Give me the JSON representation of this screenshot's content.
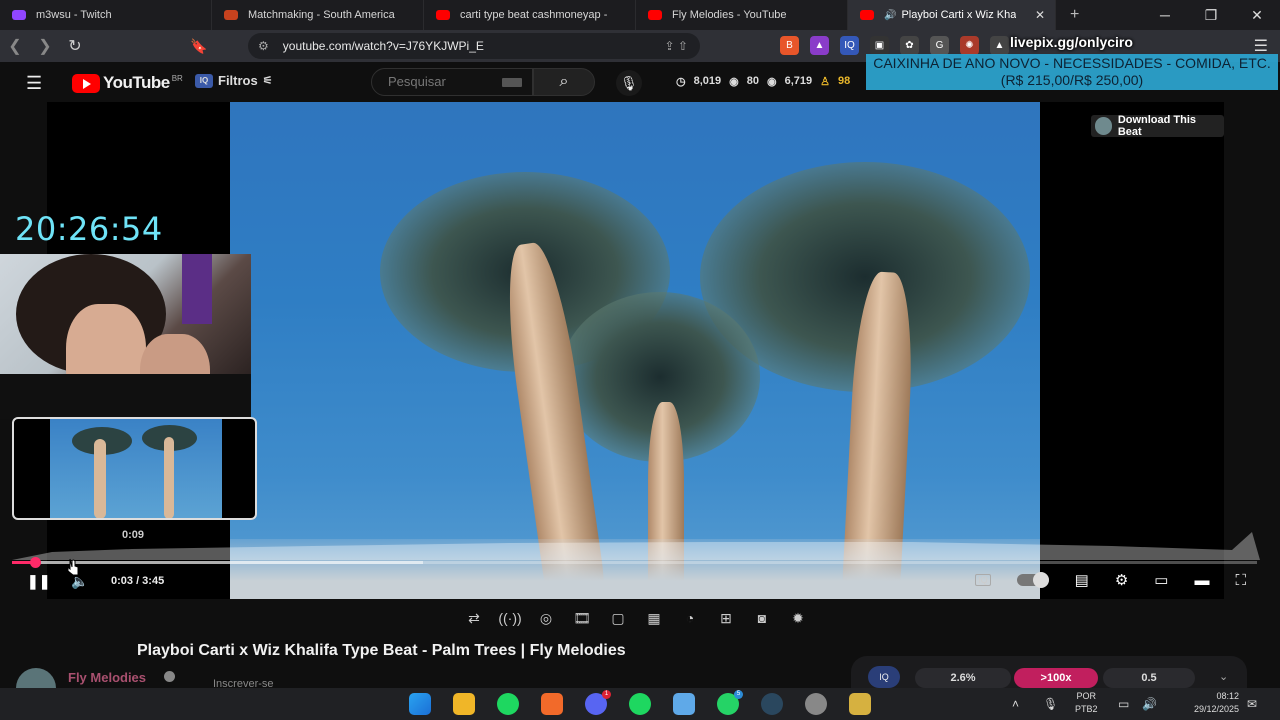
{
  "browser": {
    "tabs": [
      {
        "title": "m3wsu - Twitch",
        "color": "#9146ff"
      },
      {
        "title": "Matchmaking - South America",
        "color": "#c7421e"
      },
      {
        "title": "carti type beat cashmoneyap -",
        "color": "#ff0000"
      },
      {
        "title": "Fly Melodies - YouTube",
        "color": "#ff0000"
      },
      {
        "title": "Playboi Carti x Wiz Kha",
        "color": "#ff0000"
      }
    ],
    "new_tab": "+",
    "url": "youtube.com/watch?v=J76YKJWPi_E",
    "livepix": "livepix.gg/onlyciro"
  },
  "youtube": {
    "logo_text": "YouTube",
    "country": "BR",
    "filters_label": "Filtros",
    "search_placeholder": "Pesquisar",
    "stats": {
      "a": "8,019",
      "b": "80",
      "c": "6,719",
      "d": "98"
    }
  },
  "donation": {
    "line1": "CAIXINHA DE ANO NOVO - NECESSIDADES - COMIDA, ETC.",
    "line2": "(R$ 215,00/R$ 250,00)"
  },
  "player": {
    "download_label": "Download This Beat",
    "stream_clock": "20:26:54",
    "preview_time": "0:09",
    "time": "0:03 / 3:45",
    "progress": 0.013
  },
  "video": {
    "title": "Playboi Carti x Wiz Khalifa Type Beat - Palm Trees | Fly Melodies",
    "channel": "Fly Melodies",
    "subscribe_partial": "Inscrever-se"
  },
  "bet_widget": {
    "iq": "IQ",
    "values": [
      "2.6%",
      ">100x",
      "0.5"
    ]
  },
  "taskbar": {
    "lang_1": "POR",
    "lang_2": "PTB2",
    "time": "08:12",
    "date": "29/12/2025",
    "discord_badge": "1",
    "whatsapp_badge": "5"
  }
}
